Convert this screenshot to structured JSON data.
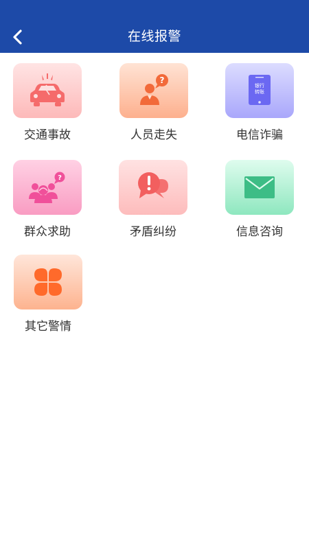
{
  "header": {
    "title": "在线报警",
    "back_icon": "chevron-left-icon",
    "color": "#1d4aa8"
  },
  "categories": [
    {
      "label": "交通事故",
      "icon": "car-crash-icon",
      "color": "#f56b6b"
    },
    {
      "label": "人员走失",
      "icon": "missing-person-icon",
      "color": "#f26a3a"
    },
    {
      "label": "电信诈骗",
      "icon": "phone-bank-transfer-icon",
      "color": "#6b68f2",
      "icon_text": [
        "银行",
        "转账"
      ]
    },
    {
      "label": "群众求助",
      "icon": "people-help-icon",
      "color": "#f0509a"
    },
    {
      "label": "矛盾纠纷",
      "icon": "dispute-chat-icon",
      "color": "#f25f5f"
    },
    {
      "label": "信息咨询",
      "icon": "mail-icon",
      "color": "#3dbd86"
    },
    {
      "label": "其它警情",
      "icon": "clover-icon",
      "color": "#ff6a2b"
    }
  ]
}
